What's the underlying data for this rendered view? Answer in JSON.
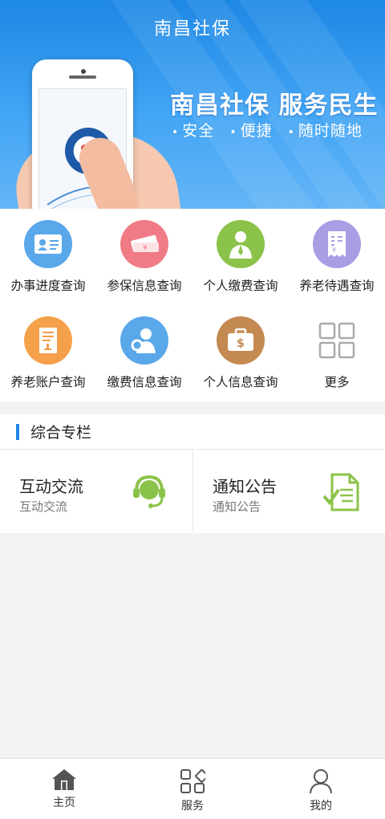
{
  "header": {
    "title": "南昌社保"
  },
  "banner": {
    "slogan": "南昌社保  服务民生",
    "features": [
      "安全",
      "便捷",
      "随时随地"
    ],
    "logo_text": "SI"
  },
  "services": [
    {
      "label": "办事进度查询",
      "icon": "id-card-icon",
      "color": "#5aa7ea"
    },
    {
      "label": "参保信息查询",
      "icon": "ticket-icon",
      "color": "#f07b87"
    },
    {
      "label": "个人缴费查询",
      "icon": "doctor-icon",
      "color": "#8bc34a"
    },
    {
      "label": "养老待遇查询",
      "icon": "receipt-icon",
      "color": "#a89ee3"
    },
    {
      "label": "养老账户查询",
      "icon": "ledger-icon",
      "color": "#f5a04a"
    },
    {
      "label": "缴费信息查询",
      "icon": "user-search-icon",
      "color": "#5aa7ea"
    },
    {
      "label": "个人信息查询",
      "icon": "briefcase-icon",
      "color": "#c48a52"
    },
    {
      "label": "更多",
      "icon": "grid-icon",
      "color": "#bbbbbb"
    }
  ],
  "section": {
    "title": "综合专栏",
    "accent": "#1e88e5",
    "cards": [
      {
        "title": "互动交流",
        "subtitle": "互动交流",
        "icon": "headset-icon",
        "color": "#8bc34a"
      },
      {
        "title": "通知公告",
        "subtitle": "通知公告",
        "icon": "document-check-icon",
        "color": "#8bc34a"
      }
    ]
  },
  "bottom_nav": [
    {
      "label": "主页",
      "icon": "home-icon",
      "active": true
    },
    {
      "label": "服务",
      "icon": "apps-icon",
      "active": false
    },
    {
      "label": "我的",
      "icon": "person-icon",
      "active": false
    }
  ]
}
